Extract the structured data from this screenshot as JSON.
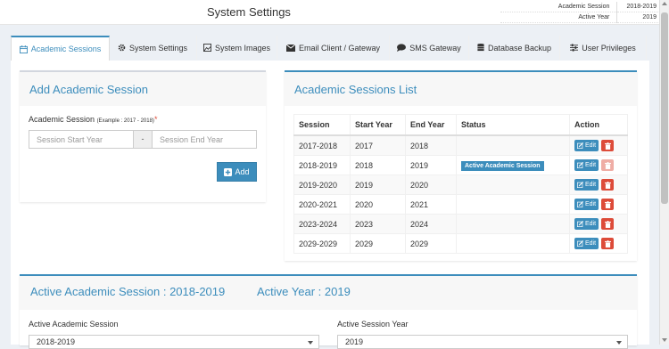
{
  "header": {
    "title": "System Settings",
    "info": [
      {
        "label": "Academic Session",
        "value": "2018-2019"
      },
      {
        "label": "Active Year",
        "value": "2019"
      }
    ]
  },
  "tabs": [
    {
      "label": "Academic Sessions",
      "icon": "calendar-icon",
      "active": true
    },
    {
      "label": "System Settings",
      "icon": "gear-icon",
      "active": false
    },
    {
      "label": "System Images",
      "icon": "image-icon",
      "active": false
    },
    {
      "label": "Email Client / Gateway",
      "icon": "envelope-icon",
      "active": false
    },
    {
      "label": "SMS Gateway",
      "icon": "chat-icon",
      "active": false
    },
    {
      "label": "Database Backup",
      "icon": "database-icon",
      "active": false
    },
    {
      "label": "User Privileges",
      "icon": "sliders-icon",
      "active": false
    }
  ],
  "add_session": {
    "title": "Add Academic Session",
    "label": "Academic Session",
    "example": "(Example : 2017 - 2018)",
    "required_mark": "*",
    "start_placeholder": "Session Start Year",
    "separator": "-",
    "end_placeholder": "Session End Year",
    "add_label": "Add"
  },
  "session_list": {
    "title": "Academic Sessions List",
    "columns": [
      "Session",
      "Start Year",
      "End Year",
      "Status",
      "Action"
    ],
    "rows": [
      {
        "session": "2017-2018",
        "start": "2017",
        "end": "2018",
        "status": "",
        "edit": "Edit",
        "delete_enabled": true
      },
      {
        "session": "2018-2019",
        "start": "2018",
        "end": "2019",
        "status": "Active Academic Session",
        "edit": "Edit",
        "delete_enabled": false
      },
      {
        "session": "2019-2020",
        "start": "2019",
        "end": "2020",
        "status": "",
        "edit": "Edit",
        "delete_enabled": true
      },
      {
        "session": "2020-2021",
        "start": "2020",
        "end": "2021",
        "status": "",
        "edit": "Edit",
        "delete_enabled": true
      },
      {
        "session": "2023-2024",
        "start": "2023",
        "end": "2024",
        "status": "",
        "edit": "Edit",
        "delete_enabled": true
      },
      {
        "session": "2029-2029",
        "start": "2029",
        "end": "2029",
        "status": "",
        "edit": "Edit",
        "delete_enabled": true
      }
    ]
  },
  "active_section": {
    "title": "Active Academic Session : 2018-2019",
    "year_title": "Active Year : 2019",
    "session_label": "Active Academic Session",
    "session_value": "2018-2019",
    "year_label": "Active Session Year",
    "year_value": "2019"
  },
  "colors": {
    "accent": "#3c8dbc",
    "danger": "#dd4b39",
    "background": "#ecf0f5"
  }
}
